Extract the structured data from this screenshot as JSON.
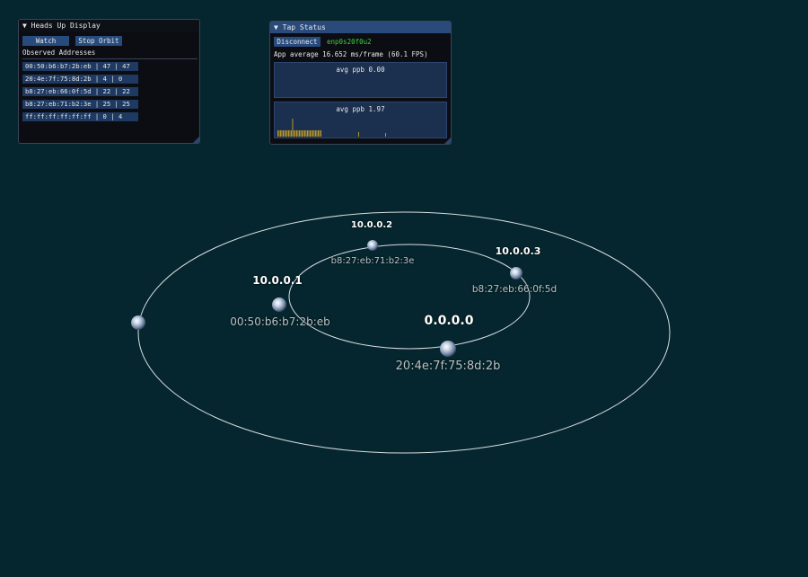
{
  "hud": {
    "title": "▼ Heads Up Display",
    "watch_label": "Watch",
    "stop_orbit_label": "Stop Orbit",
    "observed_label": "Observed Addresses",
    "addresses": [
      "00:50:b6:b7:2b:eb | 47 | 47",
      "20:4e:7f:75:8d:2b | 4 | 0",
      "b8:27:eb:66:0f:5d | 22 | 22",
      "b8:27:eb:71:b2:3e | 25 | 25",
      "ff:ff:ff:ff:ff:ff | 0 | 4"
    ]
  },
  "tap": {
    "title": "▼ Tap Status",
    "disconnect_label": "Disconnect",
    "interface": "enp0s20f0u2",
    "interface_color": "#3fcf3f",
    "fps_text": "App average 16.652 ms/frame (60.1 FPS)",
    "plot1_label": "avg ppb 0.00",
    "plot2_label": "avg ppb 1.97",
    "plot2_color": "#c9a227",
    "plot2_values": [
      7,
      7,
      7,
      7,
      7,
      7,
      7,
      7,
      7,
      7,
      7,
      20,
      7,
      7,
      7,
      7,
      7,
      7,
      7,
      7,
      7,
      7,
      7,
      7,
      7,
      7,
      7,
      7,
      7,
      7,
      7,
      7,
      7,
      0,
      0,
      0,
      0,
      0,
      0,
      0,
      0,
      0,
      0,
      0,
      0,
      0,
      0,
      0,
      0,
      0,
      0,
      0,
      0,
      0,
      0,
      0,
      0,
      0,
      0,
      0,
      5,
      0,
      0,
      0,
      0,
      0,
      0,
      0,
      0,
      0,
      0,
      0,
      0,
      0,
      0,
      0,
      0,
      0,
      0,
      0,
      4
    ]
  },
  "scene": {
    "nodes": [
      {
        "ip": "",
        "mac": ""
      },
      {
        "ip": "10.0.0.1",
        "mac": "00:50:b6:b7:2b:eb"
      },
      {
        "ip": "10.0.0.2",
        "mac": "b8:27:eb:71:b2:3e"
      },
      {
        "ip": "10.0.0.3",
        "mac": "b8:27:eb:66:0f:5d"
      },
      {
        "ip": "0.0.0.0",
        "mac": "20:4e:7f:75:8d:2b"
      }
    ]
  }
}
